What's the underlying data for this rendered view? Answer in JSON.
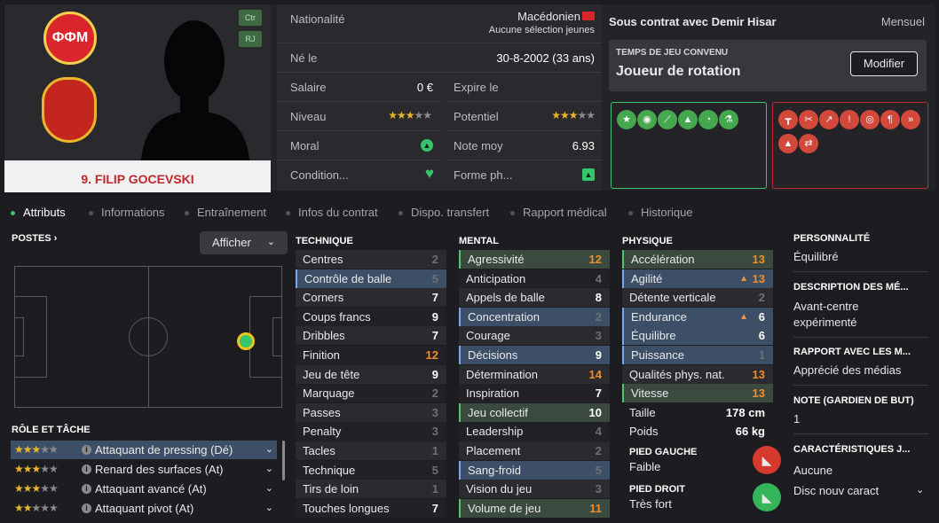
{
  "player": {
    "name": "9. FILIP GOCEVSKI",
    "positions": [
      "Ctr",
      "RJ"
    ]
  },
  "info": {
    "nationality_label": "Nationalité",
    "nationality": "Macédonien",
    "youth": "Aucune sélection jeunes",
    "born_label": "Né le",
    "born": "30-8-2002 (33 ans)",
    "salary_label": "Salaire",
    "salary": "0 €",
    "expires_label": "Expire le",
    "expires": "",
    "level_label": "Niveau",
    "level_stars": 3.5,
    "potential_label": "Potentiel",
    "potential_stars": 3.5,
    "morale_label": "Moral",
    "morale_icon": "up-arrow-icon",
    "avg_label": "Note moy",
    "avg": "6.93",
    "condition_label": "Condition...",
    "condition_icon": "heart-icon",
    "form_label": "Forme ph...",
    "form_icon": "up-arrow-icon"
  },
  "contract": {
    "status": "Sous contrat avec Demir Hisar",
    "period": "Mensuel",
    "playtime_label": "TEMPS DE JEU CONVENU",
    "playtime": "Joueur de rotation",
    "modify": "Modifier"
  },
  "tabs": [
    "Attributs",
    "Informations",
    "Entraînement",
    "Infos du contrat",
    "Dispo. transfert",
    "Rapport médical",
    "Historique"
  ],
  "positions": {
    "title": "POSTES",
    "show": "Afficher"
  },
  "technique": {
    "title": "TECHNIQUE",
    "rows": [
      {
        "n": "Centres",
        "v": "2"
      },
      {
        "n": "Contrôle de balle",
        "v": "5"
      },
      {
        "n": "Corners",
        "v": "7"
      },
      {
        "n": "Coups francs",
        "v": "9"
      },
      {
        "n": "Dribbles",
        "v": "7"
      },
      {
        "n": "Finition",
        "v": "12"
      },
      {
        "n": "Jeu de tête",
        "v": "9"
      },
      {
        "n": "Marquage",
        "v": "2"
      },
      {
        "n": "Passes",
        "v": "3"
      },
      {
        "n": "Penalty",
        "v": "3"
      },
      {
        "n": "Tacles",
        "v": "1"
      },
      {
        "n": "Technique",
        "v": "5"
      },
      {
        "n": "Tirs de loin",
        "v": "1"
      },
      {
        "n": "Touches longues",
        "v": "7"
      }
    ]
  },
  "mental": {
    "title": "MENTAL",
    "rows": [
      {
        "n": "Agressivité",
        "v": "12"
      },
      {
        "n": "Anticipation",
        "v": "4"
      },
      {
        "n": "Appels de balle",
        "v": "8"
      },
      {
        "n": "Concentration",
        "v": "2"
      },
      {
        "n": "Courage",
        "v": "3"
      },
      {
        "n": "Décisions",
        "v": "9"
      },
      {
        "n": "Détermination",
        "v": "14"
      },
      {
        "n": "Inspiration",
        "v": "7"
      },
      {
        "n": "Jeu collectif",
        "v": "10"
      },
      {
        "n": "Leadership",
        "v": "4"
      },
      {
        "n": "Placement",
        "v": "2"
      },
      {
        "n": "Sang-froid",
        "v": "5"
      },
      {
        "n": "Vision du jeu",
        "v": "3"
      },
      {
        "n": "Volume de jeu",
        "v": "11"
      }
    ]
  },
  "physique": {
    "title": "PHYSIQUE",
    "rows": [
      {
        "n": "Accélération",
        "v": "13"
      },
      {
        "n": "Agilité",
        "v": "13"
      },
      {
        "n": "Détente verticale",
        "v": "2"
      },
      {
        "n": "Endurance",
        "v": "6"
      },
      {
        "n": "Équilibre",
        "v": "6"
      },
      {
        "n": "Puissance",
        "v": "1"
      },
      {
        "n": "Qualités phys. nat.",
        "v": "13"
      },
      {
        "n": "Vitesse",
        "v": "13"
      },
      {
        "n": "Taille",
        "v": "178 cm"
      },
      {
        "n": "Poids",
        "v": "66 kg"
      }
    ]
  },
  "feet": {
    "left_label": "PIED GAUCHE",
    "left": "Faible",
    "right_label": "PIED DROIT",
    "right": "Très fort"
  },
  "side": {
    "personality_label": "PERSONNALITÉ",
    "personality": "Équilibré",
    "description_label": "DESCRIPTION DES MÉ...",
    "description": "Avant-centre expérimenté",
    "media_label": "RAPPORT AVEC LES M...",
    "media": "Apprécié des médias",
    "gk_label": "NOTE (GARDIEN DE BUT)",
    "gk": "1",
    "traits_label": "CARACTÉRISTIQUES J...",
    "traits": "Aucune",
    "traits_new": "Disc nouv caract"
  },
  "roles": {
    "title": "RÔLE ET TÂCHE",
    "items": [
      {
        "n": "Attaquant de pressing (Dé)",
        "stars": 3.5
      },
      {
        "n": "Renard des surfaces (At)",
        "stars": 3
      },
      {
        "n": "Attaquant avancé (At)",
        "stars": 3
      },
      {
        "n": "Attaquant pivot (At)",
        "stars": 2.5
      }
    ]
  },
  "colors": {
    "accent_green": "#35c56a",
    "highlight_blue": "#3c4f67",
    "highlight_green": "#3b4a3f",
    "orange": "#f08d2e"
  }
}
